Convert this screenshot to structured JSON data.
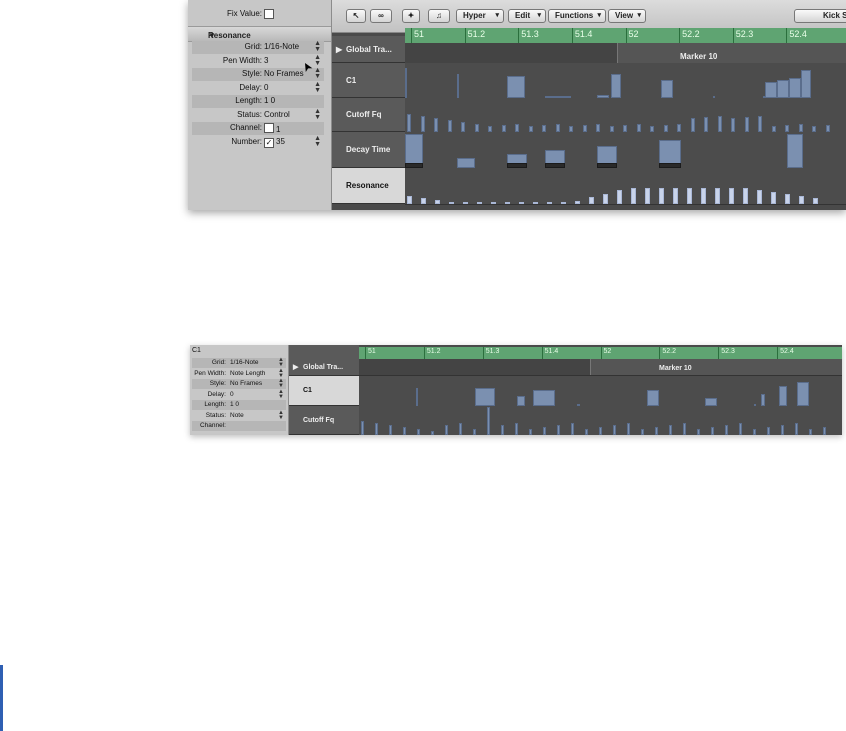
{
  "shot1": {
    "inspector": {
      "fix_value_label": "Fix Value:",
      "section_title": "Resonance",
      "rows": [
        {
          "label": "Grid:",
          "value": "1/16-Note",
          "arrows": true
        },
        {
          "label": "Pen Width:",
          "value": "3",
          "arrows": true
        },
        {
          "label": "Style:",
          "value": "No Frames",
          "arrows": true
        },
        {
          "label": "Delay:",
          "value": "0",
          "arrows": true
        },
        {
          "label": "Length:",
          "value": "1    0",
          "arrows": false
        },
        {
          "label": "Status:",
          "value": "Control",
          "arrows": true
        },
        {
          "label": "Channel:",
          "value": "1",
          "arrows": false,
          "checkbox": true,
          "checked": false
        },
        {
          "label": "Number:",
          "value": "35",
          "arrows": true,
          "checkbox": true,
          "checked": true
        }
      ]
    },
    "toolbar": {
      "menus": [
        "Hyper",
        "Edit",
        "Functions",
        "View"
      ],
      "right_text": "Kick S"
    },
    "ruler": {
      "labels": [
        "51",
        "51.2",
        "51.3",
        "51.4",
        "52",
        "52.2",
        "52.3",
        "52.4"
      ],
      "marker": "Marker 10"
    },
    "lanes": [
      {
        "name": "Global Tra...",
        "type": "global"
      },
      {
        "name": "C1"
      },
      {
        "name": "Cutoff Fq"
      },
      {
        "name": "Decay Time"
      },
      {
        "name": "Resonance",
        "selected": true
      }
    ]
  },
  "shot2": {
    "title": "C1",
    "inspector": {
      "rows": [
        {
          "label": "Grid:",
          "value": "1/16-Note",
          "arrows": true
        },
        {
          "label": "Pen Width:",
          "value": "Note Length",
          "arrows": true
        },
        {
          "label": "Style:",
          "value": "No Frames",
          "arrows": true
        },
        {
          "label": "Delay:",
          "value": "0",
          "arrows": true
        },
        {
          "label": "Length:",
          "value": "1    0",
          "arrows": false
        },
        {
          "label": "Status:",
          "value": "Note",
          "arrows": true
        },
        {
          "label": "Channel:",
          "value": "",
          "arrows": false
        }
      ]
    },
    "ruler": {
      "labels": [
        "51",
        "51.2",
        "51.3",
        "51.4",
        "52",
        "52.2",
        "52.3",
        "52.4"
      ],
      "marker": "Marker 10"
    },
    "lanes": [
      {
        "name": "Global Tra...",
        "type": "global"
      },
      {
        "name": "C1",
        "selected": true
      },
      {
        "name": "Cutoff Fq"
      }
    ]
  },
  "colors": {
    "ruler_green": "#5fa472",
    "event_blue": "#7b90b0",
    "velocity_light": "#c9d4ea",
    "page_accent": "#2f5fb3"
  }
}
